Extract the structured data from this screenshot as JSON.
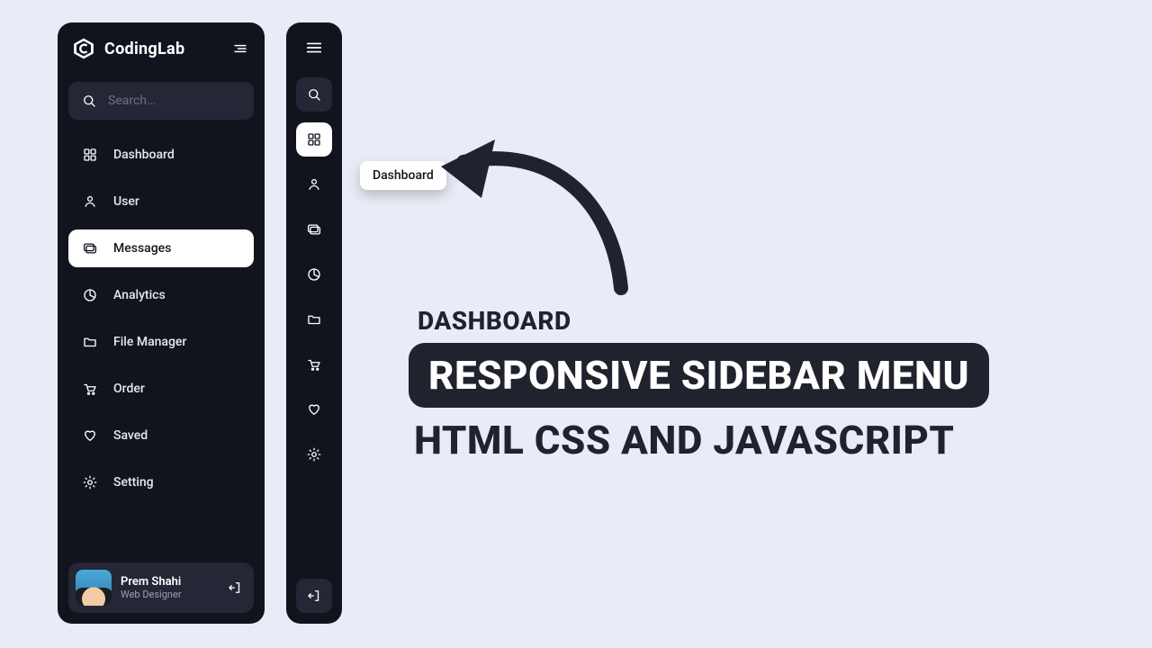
{
  "brand": {
    "name": "CodingLab"
  },
  "search": {
    "placeholder": "Search..."
  },
  "sidebar": {
    "items": [
      {
        "label": "Dashboard"
      },
      {
        "label": "User"
      },
      {
        "label": "Messages"
      },
      {
        "label": "Analytics"
      },
      {
        "label": "File Manager"
      },
      {
        "label": "Order"
      },
      {
        "label": "Saved"
      },
      {
        "label": "Setting"
      }
    ],
    "active_expanded_index": 2,
    "active_collapsed_index": 0
  },
  "tooltip": {
    "label": "Dashboard"
  },
  "user": {
    "name": "Prem Shahi",
    "role": "Web Designer"
  },
  "headline": {
    "eyebrow": "DASHBOARD",
    "pill": "RESPONSIVE SIDEBAR MENU",
    "sub": "HTML CSS AND JAVASCRIPT"
  },
  "colors": {
    "panel": "#12141d",
    "panel_alt": "#242735",
    "page": "#e9ecf6",
    "white": "#ffffff"
  }
}
